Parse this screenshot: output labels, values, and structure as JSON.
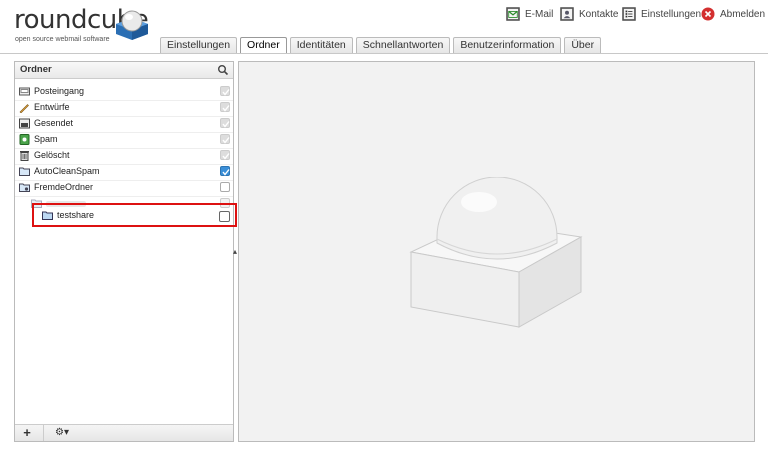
{
  "logo": {
    "wordmark": "roundcube",
    "tagline": "open source webmail software"
  },
  "topnav": [
    {
      "label": "E-Mail",
      "icon": "mail-icon"
    },
    {
      "label": "Kontakte",
      "icon": "contacts-icon"
    },
    {
      "label": "Einstellungen",
      "icon": "settings-icon"
    },
    {
      "label": "Abmelden",
      "icon": "logout-icon"
    }
  ],
  "tabs": [
    {
      "label": "Einstellungen",
      "active": false
    },
    {
      "label": "Ordner",
      "active": true
    },
    {
      "label": "Identitäten",
      "active": false
    },
    {
      "label": "Schnellantworten",
      "active": false
    },
    {
      "label": "Benutzerinformation",
      "active": false
    },
    {
      "label": "Über",
      "active": false
    }
  ],
  "folders": {
    "title": "Ordner",
    "items": [
      {
        "label": "Posteingang",
        "icon": "inbox-icon",
        "subscribed": true,
        "locked": true
      },
      {
        "label": "Entwürfe",
        "icon": "drafts-icon",
        "subscribed": true,
        "locked": true
      },
      {
        "label": "Gesendet",
        "icon": "sent-icon",
        "subscribed": true,
        "locked": true
      },
      {
        "label": "Spam",
        "icon": "spam-icon",
        "subscribed": true,
        "locked": true
      },
      {
        "label": "Gelöscht",
        "icon": "trash-icon",
        "subscribed": true,
        "locked": true
      },
      {
        "label": "AutoCleanSpam",
        "icon": "folder-icon",
        "subscribed": true,
        "locked": false
      },
      {
        "label": "FremdeOrdner",
        "icon": "shared-folder-icon",
        "subscribed": false,
        "locked": false
      },
      {
        "label": "",
        "icon": "folder-icon",
        "subscribed": false,
        "locked": true
      },
      {
        "label": "testshare",
        "icon": "folder-icon",
        "subscribed": false,
        "locked": false
      }
    ],
    "footer": {
      "add": "+",
      "gear": "⚙▾"
    }
  },
  "colors": {
    "accent": "#3b8fd8",
    "highlight": "#dd1111",
    "logout": "#d32f2f"
  }
}
